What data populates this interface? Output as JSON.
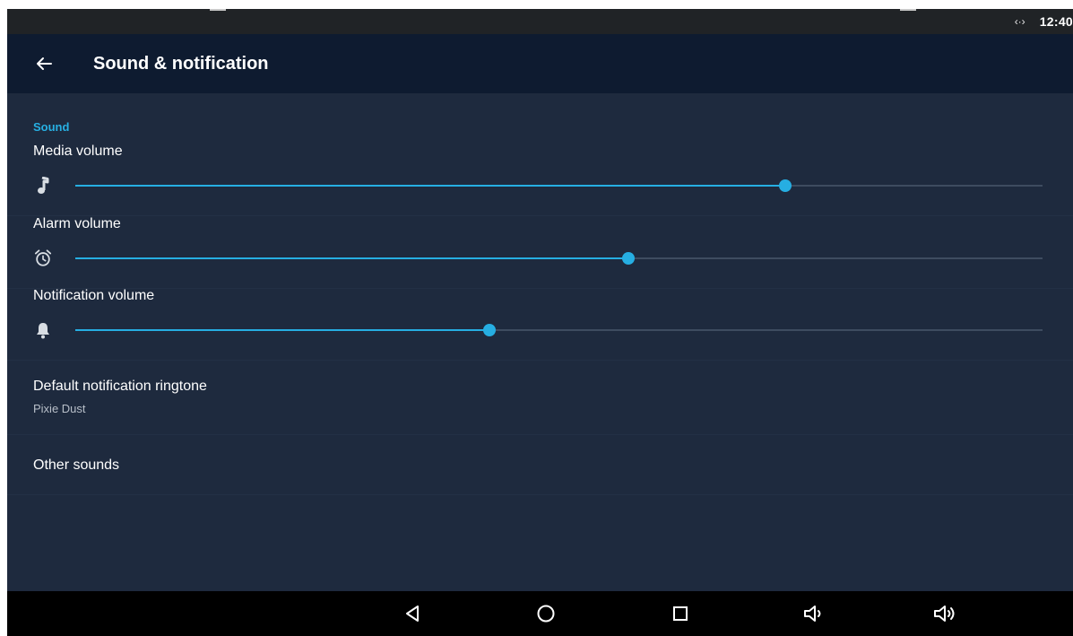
{
  "status_bar": {
    "sync_indicator": "‹·›",
    "clock": "12:40"
  },
  "app_bar": {
    "title": "Sound & notification",
    "back_icon": "arrow-back-icon"
  },
  "section": {
    "header": "Sound"
  },
  "volumes": [
    {
      "label": "Media volume",
      "icon": "music-note-icon",
      "level": 0.734
    },
    {
      "label": "Alarm volume",
      "icon": "alarm-clock-icon",
      "level": 0.572
    },
    {
      "label": "Notification volume",
      "icon": "bell-icon",
      "level": 0.428
    }
  ],
  "ringtone": {
    "title": "Default notification ringtone",
    "summary": "Pixie Dust"
  },
  "other_sounds": {
    "title": "Other sounds"
  },
  "nav_bar": {
    "buttons": [
      "back-icon",
      "home-icon",
      "recents-icon",
      "volume-down-icon",
      "volume-up-icon"
    ]
  },
  "colors": {
    "accent": "#26aee2",
    "background": "#1e2a3e",
    "app_bar": "#0e1b30",
    "status_bar": "#202326",
    "nav_bar": "#000000"
  }
}
